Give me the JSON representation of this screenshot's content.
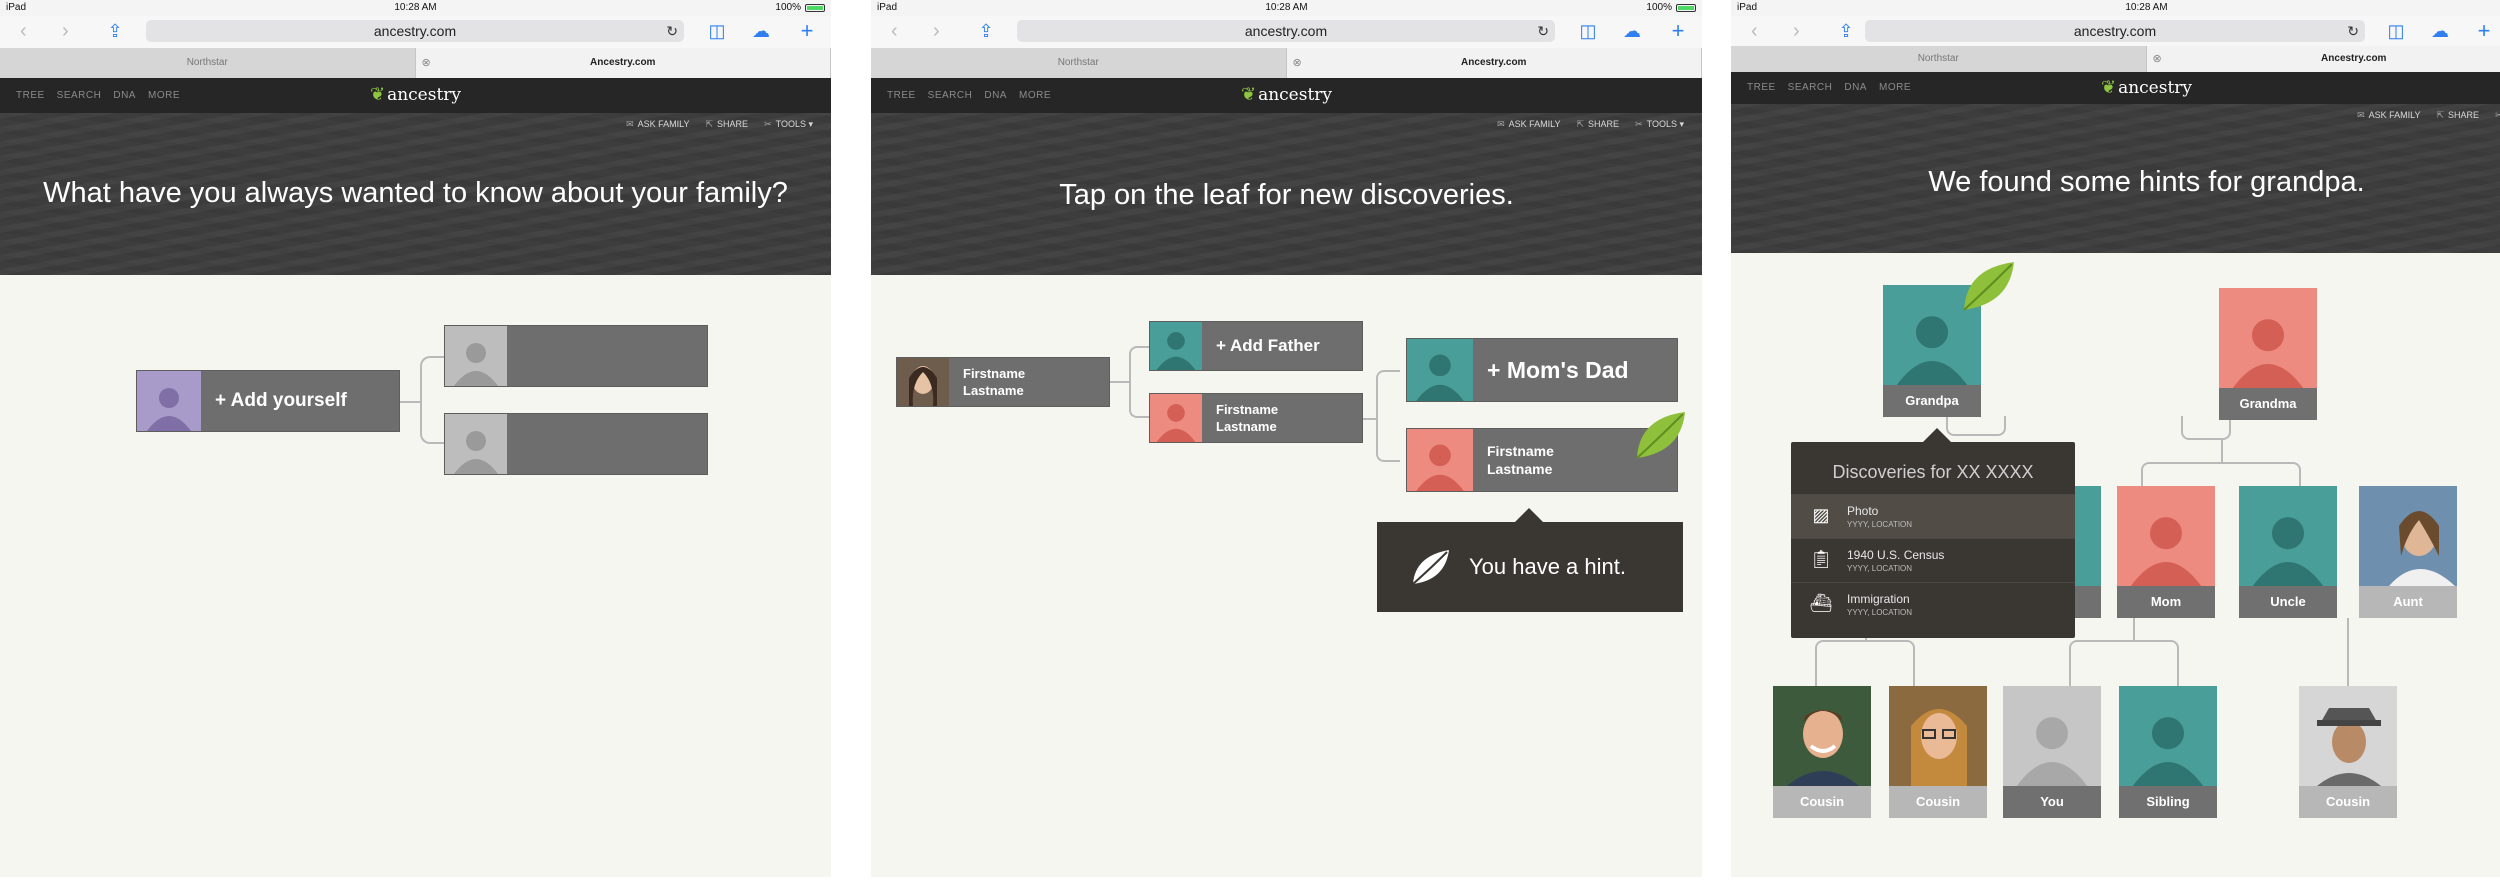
{
  "status": {
    "device": "iPad",
    "time": "10:28 AM",
    "battery": "100%"
  },
  "browser": {
    "url": "ancestry.com",
    "tabs": [
      "Northstar",
      "Ancestry.com"
    ]
  },
  "site": {
    "nav": [
      "TREE",
      "SEARCH",
      "DNA",
      "MORE"
    ],
    "logo": "ancestry",
    "actions": [
      "ASK FAMILY",
      "SHARE",
      "TOOLS"
    ]
  },
  "screen1": {
    "headline": "What have you always wanted to know about your family?",
    "add_yourself": "+ Add yourself"
  },
  "screen2": {
    "headline": "Tap on the leaf for new discoveries.",
    "person_name": "Firstname Lastname",
    "add_father": "+ Add Father",
    "mother": "Firstname Lastname",
    "moms_dad": "+ Mom's Dad",
    "moms_mom": "Firstname Lastname",
    "hint": "You have a hint."
  },
  "screen3": {
    "headline": "We found some hints for grandpa.",
    "grandpa": "Grandpa",
    "grandma": "Grandma",
    "mom": "Mom",
    "uncle": "Uncle",
    "aunt": "Aunt",
    "cousin1": "Cousin",
    "cousin2": "Cousin",
    "you": "You",
    "sibling": "Sibling",
    "cousin3": "Cousin",
    "discoveries": {
      "title": "Discoveries for XX XXXX",
      "items": [
        {
          "title": "Photo",
          "sub": "YYYY, LOCATION"
        },
        {
          "title": "1940 U.S. Census",
          "sub": "YYYY, LOCATION"
        },
        {
          "title": "Immigration",
          "sub": "YYYY, LOCATION"
        }
      ]
    }
  },
  "colors": {
    "teal": "#4a9e9a",
    "salmon": "#ee8b80",
    "purple": "#a99bc9",
    "gray": "#bdbdbd",
    "leaf": "#8fc03b"
  }
}
